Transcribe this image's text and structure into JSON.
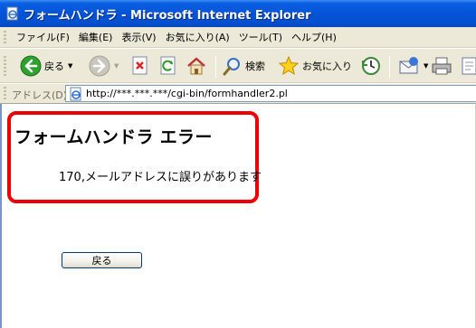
{
  "window": {
    "title": "フォームハンドラ - Microsoft Internet Explorer",
    "icon": "ie-page-icon"
  },
  "menu": {
    "items": [
      {
        "label": "ファイル(F)"
      },
      {
        "label": "編集(E)"
      },
      {
        "label": "表示(V)"
      },
      {
        "label": "お気に入り(A)"
      },
      {
        "label": "ツール(T)"
      },
      {
        "label": "ヘルプ(H)"
      }
    ]
  },
  "toolbar": {
    "back_label": "戻る",
    "search_label": "検索",
    "favorites_label": "お気に入り",
    "icons": [
      "back-arrow-icon",
      "forward-arrow-icon",
      "stop-icon",
      "refresh-icon",
      "home-icon",
      "search-icon",
      "favorites-star-icon",
      "history-icon",
      "mail-icon",
      "print-icon",
      "edit-icon"
    ]
  },
  "address": {
    "label": "アドレス(D)",
    "value": "http://***.***.***/cgi-bin/formhandler2.pl"
  },
  "page": {
    "error_title": "フォームハンドラ エラー",
    "error_message": "170,メールアドレスに誤りがあります",
    "back_button_label": "戻る"
  },
  "colors": {
    "titlebar": "#0553d6",
    "highlight_border": "#ee0000",
    "chrome": "#ece9d8"
  }
}
